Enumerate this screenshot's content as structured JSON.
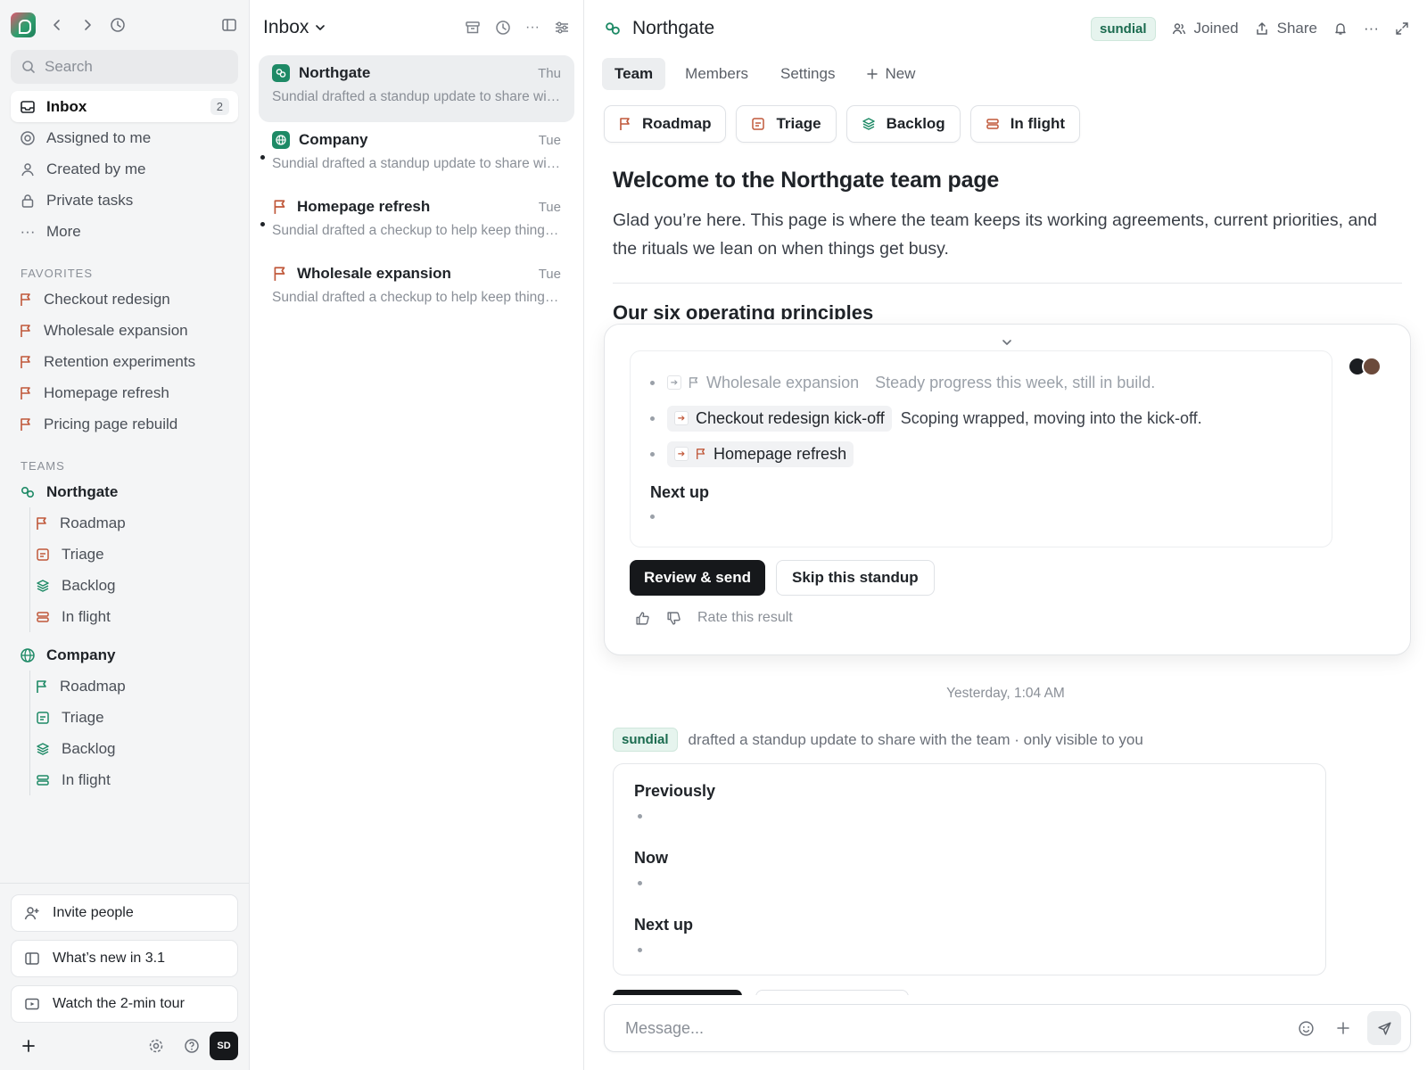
{
  "sidebar": {
    "search_placeholder": "Search",
    "nav": [
      {
        "label": "Inbox",
        "badge": "2",
        "icon": "inbox-icon"
      },
      {
        "label": "Assigned to me",
        "icon": "target-icon"
      },
      {
        "label": "Created by me",
        "icon": "user-icon"
      },
      {
        "label": "Private tasks",
        "icon": "lock-icon"
      },
      {
        "label": "More",
        "icon": "ellipsis-icon"
      }
    ],
    "favorites_label": "FAVORITES",
    "favorites": [
      "Checkout redesign",
      "Wholesale expansion",
      "Retention experiments",
      "Homepage refresh",
      "Pricing page rebuild"
    ],
    "teams_label": "TEAMS",
    "teams": [
      {
        "name": "Northgate",
        "items": [
          "Roadmap",
          "Triage",
          "Backlog",
          "In flight"
        ]
      },
      {
        "name": "Company",
        "items": [
          "Roadmap",
          "Triage",
          "Backlog",
          "In flight"
        ]
      }
    ],
    "bottom": {
      "invite": "Invite people",
      "whats_new": "What’s new in 3.1",
      "tour": "Watch the 2-min tour",
      "avatar_initials": "SD"
    }
  },
  "inbox": {
    "title": "Inbox",
    "messages": [
      {
        "title": "Northgate",
        "date": "Thu",
        "preview": "Sundial drafted a standup update to share with the team"
      },
      {
        "title": "Company",
        "date": "Tue",
        "preview": "Sundial drafted a standup update to share with the team"
      },
      {
        "title": "Homepage refresh",
        "date": "Tue",
        "preview": "Sundial drafted a checkup to help keep things moving"
      },
      {
        "title": "Wholesale expansion",
        "date": "Tue",
        "preview": "Sundial drafted a checkup to help keep things moving"
      }
    ]
  },
  "main": {
    "title": "Northgate",
    "sundial_badge": "sundial",
    "joined": "Joined",
    "share": "Share",
    "tabs": [
      "Team",
      "Members",
      "Settings"
    ],
    "new_tab": "New",
    "views": [
      "Roadmap",
      "Triage",
      "Backlog",
      "In flight"
    ],
    "doc": {
      "heading": "Welcome to the Northgate team page",
      "body": "Glad you’re here. This page is where the team keeps its working agreements, current priorities, and the rituals we lean on when things get busy.",
      "subheading": "Our six operating principles"
    },
    "standup": {
      "items": [
        {
          "chip": "Wholesale expansion",
          "text": "Steady progress this week, still in build."
        },
        {
          "chip": "Checkout redesign kick-off",
          "text": "Scoping wrapped, moving into the kick-off."
        },
        {
          "chip": "Homepage refresh",
          "text": ""
        }
      ],
      "next_up": "Next up",
      "review_button": "Review & send",
      "skip_button": "Skip this standup",
      "rate_label": "Rate this result"
    },
    "timestamp": "Yesterday, 1:04 AM",
    "drafted_badge": "sundial",
    "drafted_text": "drafted a standup update to share with the team · only visible to you",
    "draft_sections": [
      "Previously",
      "Now",
      "Next up"
    ],
    "composer_placeholder": "Message..."
  },
  "colors": {
    "accent_green": "#1e8a66",
    "flag_orange": "#c0583a",
    "primary_button": "#16181b"
  }
}
